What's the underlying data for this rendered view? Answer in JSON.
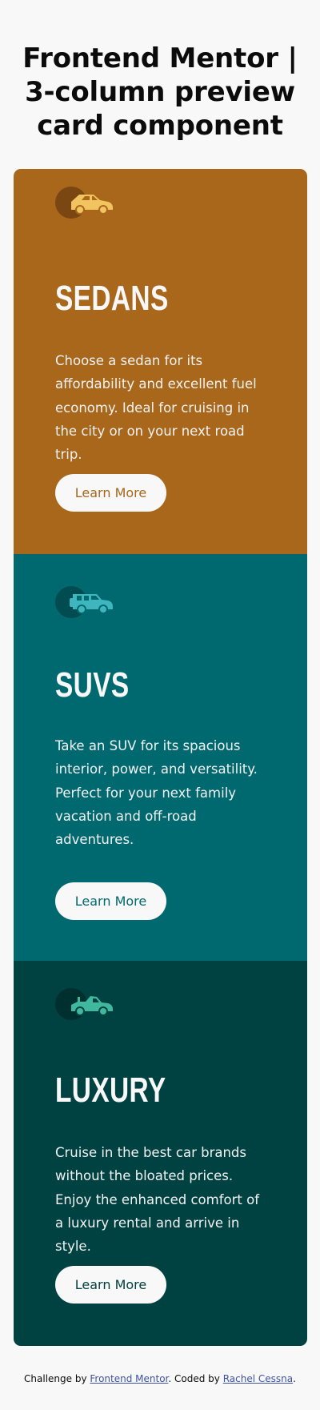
{
  "page": {
    "title": "Frontend Mentor | 3-column preview card component",
    "background": "#f8f8f9"
  },
  "cards": [
    {
      "icon": "sedan-car-icon",
      "title": "SEDANS",
      "text": "Choose a sedan for its affordability and excellent fuel economy. Ideal for cruising in the city or on your next road trip.",
      "button_label": "Learn More",
      "color": "#a8671b"
    },
    {
      "icon": "suv-car-icon",
      "title": "SUVS",
      "text": "Take an SUV for its spacious interior, power, and versatility. Perfect for your next family vacation and off-road adventures.",
      "button_label": "Learn More",
      "color": "#006970"
    },
    {
      "icon": "luxury-car-icon",
      "title": "LUXURY",
      "text": "Cruise in the best car brands without the bloated prices. Enjoy the enhanced comfort of a luxury rental and arrive in style.",
      "button_label": "Learn More",
      "color": "#004141"
    }
  ],
  "attribution": {
    "prefix": "Challenge by ",
    "link1_text": "Frontend Mentor",
    "middle": ". Coded by ",
    "link2_text": "Rachel Cessna",
    "suffix": ".",
    "link_color": "#3e52a3"
  }
}
